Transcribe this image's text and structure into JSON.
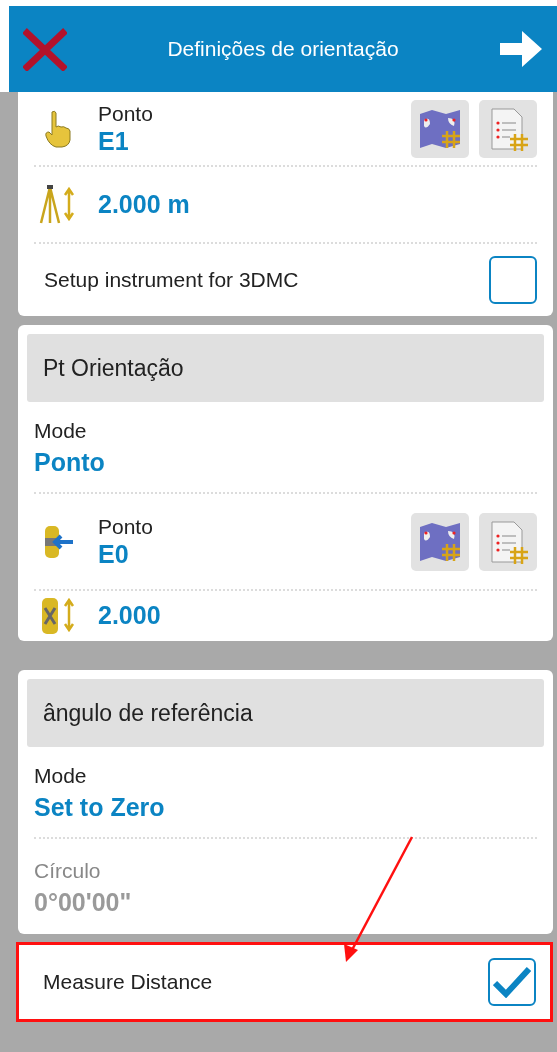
{
  "header": {
    "title": "Definições de orientação"
  },
  "sections": [
    {
      "items": [
        {
          "kind": "point",
          "label": "Ponto",
          "value": "E1"
        },
        {
          "kind": "height",
          "value": "2.000 m"
        },
        {
          "kind": "checkbox",
          "label": "Setup instrument for 3DMC",
          "checked": false
        }
      ]
    },
    {
      "title": "Pt Orientação",
      "items": [
        {
          "kind": "mode",
          "label": "Mode",
          "value": "Ponto",
          "disabled": false
        },
        {
          "kind": "point",
          "label": "Ponto",
          "value": "E0"
        },
        {
          "kind": "height",
          "value": "2.000"
        }
      ]
    },
    {
      "title": "ângulo de referência",
      "items": [
        {
          "kind": "mode",
          "label": "Mode",
          "value": "Set to Zero",
          "disabled": false
        },
        {
          "kind": "mode",
          "label": "Círculo",
          "value": "0°00'00\"",
          "disabled": true
        }
      ]
    }
  ],
  "footer": {
    "label": "Measure Distance",
    "checked": true,
    "highlighted": true
  }
}
